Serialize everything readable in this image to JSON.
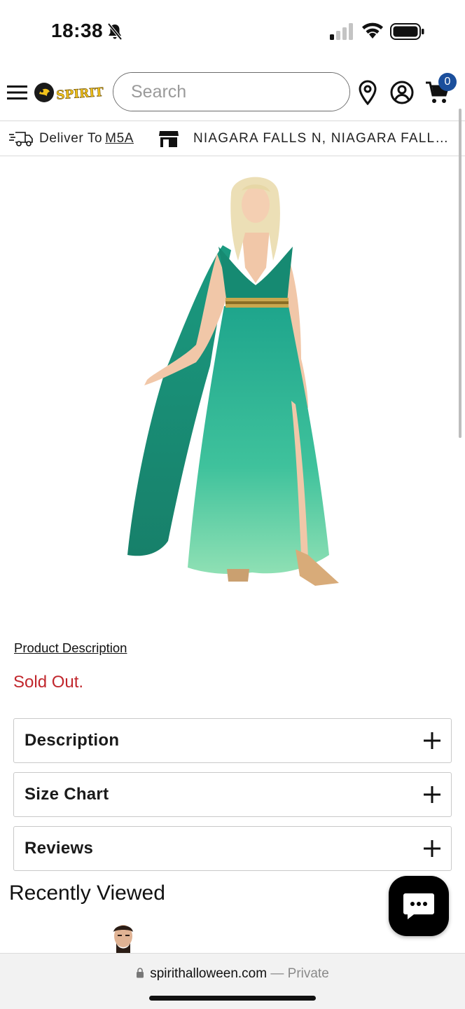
{
  "status_bar": {
    "time": "18:38"
  },
  "header": {
    "logo_text": "SPIRIT",
    "search": {
      "placeholder": "Search",
      "value": ""
    },
    "cart_count": "0"
  },
  "delivery": {
    "deliver_to_label": "Deliver To",
    "postal_code": "M5A",
    "store_name": "NIAGARA FALLS N, NIAGARA FALLS, ON"
  },
  "product": {
    "description_link": "Product Description",
    "stock_status": "Sold Out."
  },
  "accordions": [
    {
      "title": "Description"
    },
    {
      "title": "Size Chart"
    },
    {
      "title": "Reviews"
    }
  ],
  "recently_viewed": {
    "heading": "Recently Viewed"
  },
  "browser": {
    "url": "spirithalloween.com",
    "separator": " — ",
    "mode": "Private"
  },
  "colors": {
    "sold_out": "#c1272d",
    "cart_badge": "#1b4f9c",
    "dress_teal": "#1a9a82",
    "logo_yellow": "#f1c21b"
  }
}
